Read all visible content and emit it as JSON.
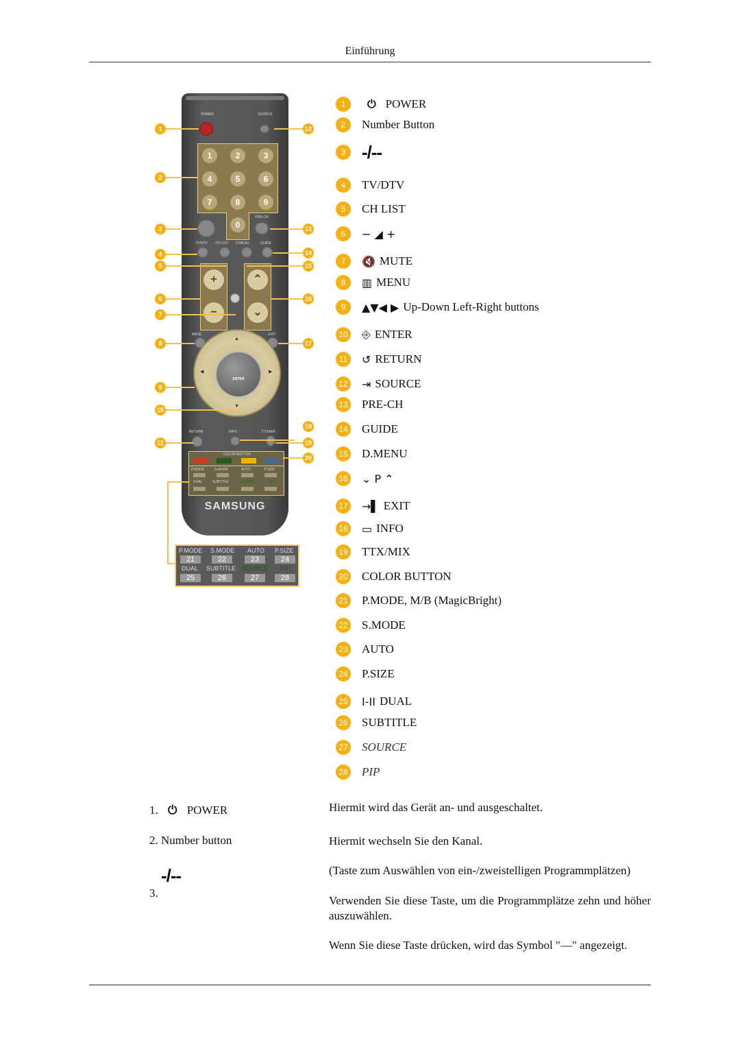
{
  "header": {
    "title": "Einführung"
  },
  "remote": {
    "brand": "SAMSUNG",
    "labels": {
      "power": "POWER",
      "source": "SOURCE",
      "tvdtv": "TV/DTV",
      "chlist": "CH LIST",
      "dmenu": "D.MENU",
      "guide": "GUIDE",
      "prech": "PRE-CH",
      "mute": "MUTE",
      "menu": "MENU",
      "exit": "EXIT",
      "return": "RETURN",
      "info": "INFO",
      "ttxmix": "TTX/MIX",
      "color_button": "COLOR BUTTON",
      "enter": "ENTER"
    },
    "number_keys": [
      "1",
      "2",
      "3",
      "4",
      "5",
      "6",
      "7",
      "8",
      "9",
      "0"
    ],
    "color_buttons": [
      "#c84020",
      "#2a5a18",
      "#f8b000",
      "#4a6a8a"
    ],
    "mode_keys": [
      {
        "label": "P.MODE",
        "number": "21"
      },
      {
        "label": "S.MODE",
        "number": "22"
      },
      {
        "label": "AUTO",
        "number": "23"
      },
      {
        "label": "P.SIZE",
        "number": "24"
      },
      {
        "label": "DUAL",
        "number": "25"
      },
      {
        "label": "SUBTITLE",
        "number": "26"
      },
      {
        "label": "SOURCE",
        "number": "27"
      },
      {
        "label": "PIP",
        "number": "28"
      }
    ],
    "callouts": [
      "1",
      "2",
      "3",
      "4",
      "5",
      "6",
      "7",
      "8",
      "9",
      "10",
      "11",
      "12",
      "13",
      "14",
      "15",
      "16",
      "17",
      "18",
      "19",
      "20"
    ]
  },
  "legend": [
    {
      "num": "1",
      "icon": "power-icon",
      "glyph": "⏻",
      "label": "POWER"
    },
    {
      "num": "2",
      "icon": "",
      "glyph": "",
      "label": "Number Button"
    },
    {
      "num": "3",
      "icon": "dash-slash-icon",
      "glyph": "-/--",
      "label": ""
    },
    {
      "num": "4",
      "icon": "",
      "glyph": "",
      "label": "TV/DTV"
    },
    {
      "num": "5",
      "icon": "",
      "glyph": "",
      "label": "CH LIST"
    },
    {
      "num": "6",
      "icon": "volume-icon",
      "glyph": "− ◢ +",
      "label": ""
    },
    {
      "num": "7",
      "icon": "mute-icon",
      "glyph": "🔇",
      "label": "MUTE"
    },
    {
      "num": "8",
      "icon": "menu-icon",
      "glyph": "▥",
      "label": "MENU"
    },
    {
      "num": "9",
      "icon": "arrows-icon",
      "glyph": "▲▼◀ ▶",
      "label": "Up-Down Left-Right buttons"
    },
    {
      "num": "10",
      "icon": "enter-icon",
      "glyph": "⎆",
      "label": "ENTER"
    },
    {
      "num": "11",
      "icon": "return-icon",
      "glyph": "↺",
      "label": "RETURN"
    },
    {
      "num": "12",
      "icon": "source-icon",
      "glyph": "⇥",
      "label": "SOURCE"
    },
    {
      "num": "13",
      "icon": "",
      "glyph": "",
      "label": "PRE-CH"
    },
    {
      "num": "14",
      "icon": "",
      "glyph": "",
      "label": "GUIDE"
    },
    {
      "num": "15",
      "icon": "",
      "glyph": "",
      "label": "D.MENU"
    },
    {
      "num": "16",
      "icon": "channel-icon",
      "glyph": "⌄ P ⌃",
      "label": ""
    },
    {
      "num": "17",
      "icon": "exit-icon",
      "glyph": "→▌",
      "label": "EXIT"
    },
    {
      "num": "18",
      "icon": "info-icon",
      "glyph": "▭",
      "label": "INFO"
    },
    {
      "num": "19",
      "icon": "",
      "glyph": "",
      "label": "TTX/MIX"
    },
    {
      "num": "20",
      "icon": "",
      "glyph": "",
      "label": "COLOR BUTTON"
    },
    {
      "num": "21",
      "icon": "",
      "glyph": "",
      "label": "P.MODE, M/B (MagicBright)"
    },
    {
      "num": "22",
      "icon": "",
      "glyph": "",
      "label": "S.MODE"
    },
    {
      "num": "23",
      "icon": "",
      "glyph": "",
      "label": "AUTO"
    },
    {
      "num": "24",
      "icon": "",
      "glyph": "",
      "label": "P.SIZE"
    },
    {
      "num": "25",
      "icon": "dual-icon",
      "glyph": "I-II",
      "label": "DUAL"
    },
    {
      "num": "26",
      "icon": "",
      "glyph": "",
      "label": "SUBTITLE"
    },
    {
      "num": "27",
      "icon": "",
      "glyph": "",
      "label": "SOURCE",
      "italic": true
    },
    {
      "num": "28",
      "icon": "",
      "glyph": "",
      "label": "PIP",
      "italic": true
    }
  ],
  "descriptions": [
    {
      "term_prefix": "1.",
      "term": "POWER",
      "text": [
        "Hiermit wird das Gerät an- und ausgeschaltet."
      ]
    },
    {
      "term_prefix": "2.",
      "term": "Number button",
      "text": [
        "Hiermit wechseln Sie den Kanal."
      ]
    },
    {
      "term_prefix": "3.",
      "term": "-/--",
      "text": [
        "(Taste zum Auswählen von ein-/zweistelligen Programmplätzen)",
        "Verwenden Sie diese Taste, um die Programmplätze zehn und höher auszuwählen.",
        "Wenn Sie diese Taste drücken, wird das Symbol \"—\" angezeigt."
      ]
    }
  ]
}
